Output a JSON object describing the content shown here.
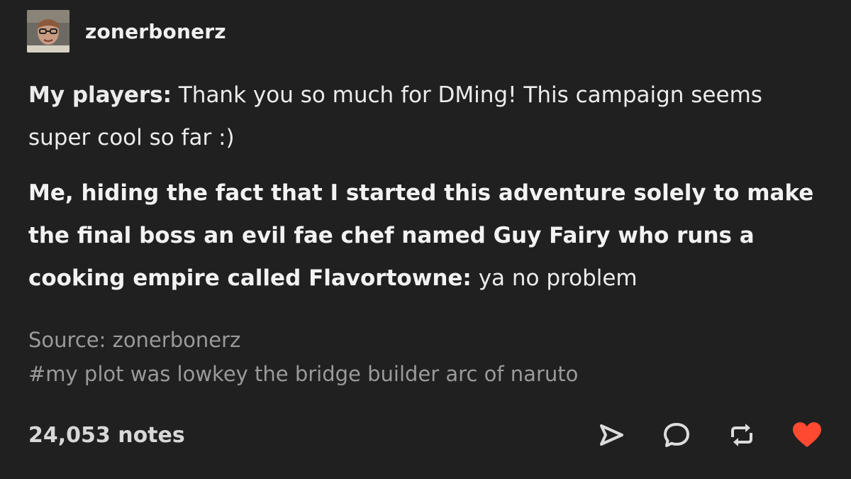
{
  "post": {
    "username": "zonerbonerz",
    "paragraph1": {
      "speaker": "My players:",
      "text": " Thank you so much for DMing! This campaign seems super cool so far :)"
    },
    "paragraph2": {
      "speaker": "Me, hiding the fact that I started this adventure solely to make the final boss an evil fae chef named Guy Fairy who runs a cooking empire called Flavortowne:",
      "text": " ya no problem"
    },
    "source": "Source: zonerbonerz",
    "tag": "#my plot was lowkey the bridge builder arc of naruto",
    "notes": "24,053 notes"
  },
  "icons": {
    "avatar": "user-avatar",
    "share": "share-icon",
    "reply": "reply-icon",
    "reblog": "reblog-icon",
    "like": "heart-icon"
  },
  "colors": {
    "background": "#202020",
    "text": "#ececec",
    "muted": "#9a9a9a",
    "like": "#ff4930"
  }
}
